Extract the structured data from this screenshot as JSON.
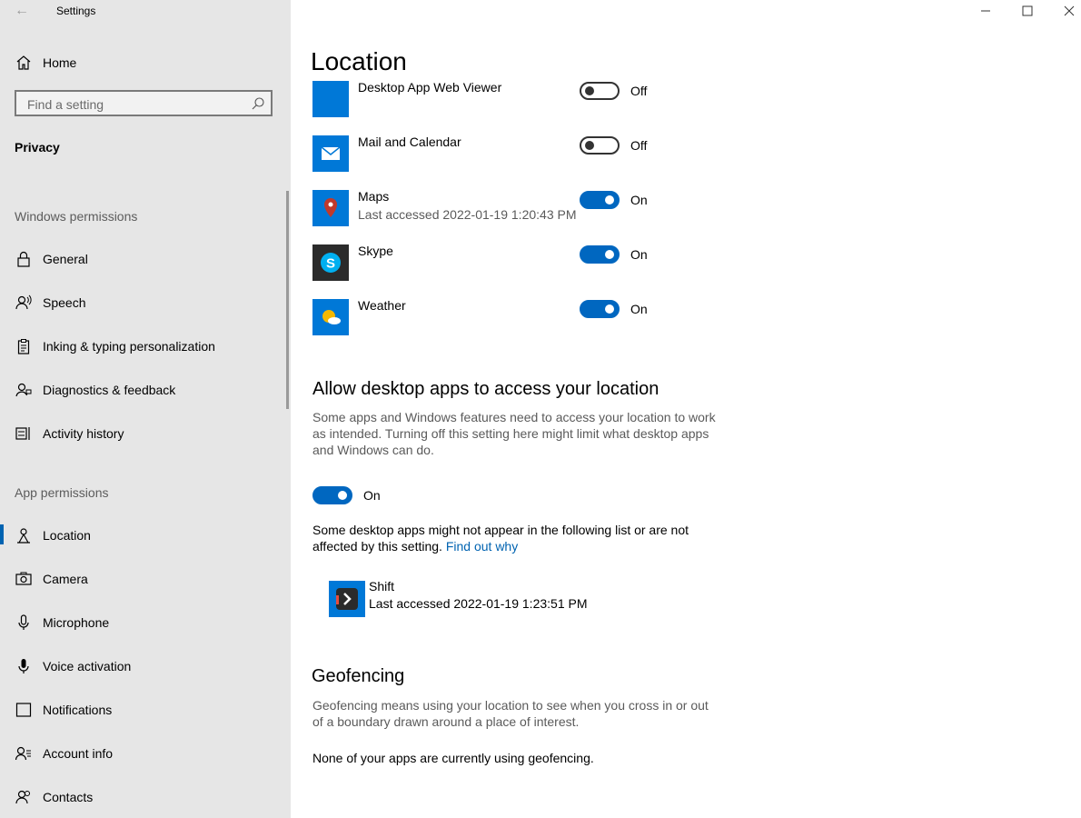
{
  "window": {
    "title": "Settings",
    "back_glyph": "←",
    "controls": {
      "minimize": "—",
      "maximize": "☐",
      "close": "✕"
    }
  },
  "sidebar": {
    "home_label": "Home",
    "search_placeholder": "Find a setting",
    "section_title": "Privacy",
    "windows_permissions_label": "Windows permissions",
    "windows_permissions": [
      {
        "label": "General",
        "icon": "lock-icon"
      },
      {
        "label": "Speech",
        "icon": "speech-icon"
      },
      {
        "label": "Inking & typing personalization",
        "icon": "clipboard-icon"
      },
      {
        "label": "Diagnostics & feedback",
        "icon": "diagnostics-icon"
      },
      {
        "label": "Activity history",
        "icon": "activity-icon"
      }
    ],
    "app_permissions_label": "App permissions",
    "app_permissions": [
      {
        "label": "Location",
        "icon": "location-icon",
        "selected": true
      },
      {
        "label": "Camera",
        "icon": "camera-icon"
      },
      {
        "label": "Microphone",
        "icon": "microphone-icon"
      },
      {
        "label": "Voice activation",
        "icon": "voice-icon"
      },
      {
        "label": "Notifications",
        "icon": "notifications-icon"
      },
      {
        "label": "Account info",
        "icon": "account-icon"
      },
      {
        "label": "Contacts",
        "icon": "contacts-icon"
      }
    ]
  },
  "main": {
    "title": "Location",
    "apps": [
      {
        "name": "Desktop App Web Viewer",
        "sub": "",
        "state": "Off",
        "tile_color": "#0078d7"
      },
      {
        "name": "Mail and Calendar",
        "sub": "",
        "state": "Off",
        "tile_color": "#0078d7"
      },
      {
        "name": "Maps",
        "sub": "Last accessed 2022-01-19 1:20:43 PM",
        "state": "On",
        "tile_color": "#0078d7"
      },
      {
        "name": "Skype",
        "sub": "",
        "state": "On",
        "tile_color": "#2b2b2b"
      },
      {
        "name": "Weather",
        "sub": "",
        "state": "On",
        "tile_color": "#0078d7"
      }
    ],
    "desktop": {
      "heading": "Allow desktop apps to access your location",
      "description": "Some apps and Windows features need to access your location to work as intended. Turning off this setting here might limit what desktop apps and Windows can do.",
      "toggle_state": "On",
      "note": "Some desktop apps might not appear in the following list or are not affected by this setting.",
      "link": "Find out why",
      "app": {
        "name": "Shift",
        "sub": "Last accessed 2022-01-19 1:23:51 PM"
      }
    },
    "geofencing": {
      "heading": "Geofencing",
      "description": "Geofencing means using your location to see when you cross in or out of a boundary drawn around a place of interest.",
      "status": "None of your apps are currently using geofencing."
    }
  },
  "colors": {
    "accent": "#0067c0",
    "sidebar_bg": "#e6e6e6",
    "link": "#0063b1"
  }
}
